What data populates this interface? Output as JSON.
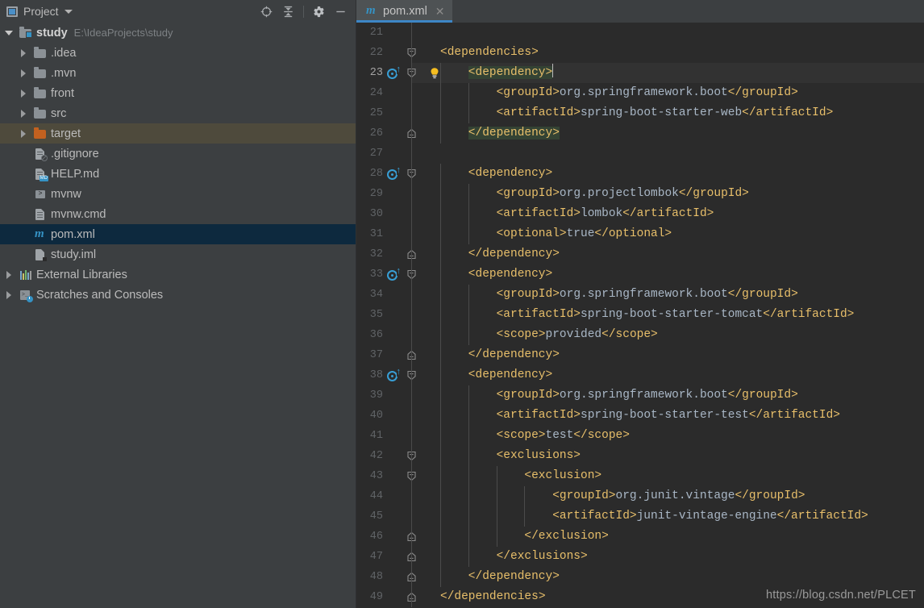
{
  "window": {
    "theme_bg": "#3c3f41",
    "editor_bg": "#2b2b2b",
    "accent": "#3d86c6"
  },
  "sidebar": {
    "header": {
      "title": "Project",
      "project_icon": "project-panel-icon",
      "dropdown_icon": "chevron-down-icon",
      "tools": [
        {
          "name": "locate-icon",
          "label": "⊕"
        },
        {
          "name": "collapse-all-icon",
          "label": "≛"
        },
        {
          "name": "settings-gear-icon",
          "label": "⚙"
        },
        {
          "name": "hide-icon",
          "label": "—"
        }
      ]
    },
    "tree": [
      {
        "label": "study",
        "sub": "E:\\IdeaProjects\\study",
        "icon": "module-folder-icon",
        "arrow": "open",
        "indent": 0,
        "state": "normal",
        "bold": true
      },
      {
        "label": ".idea",
        "sub": "",
        "icon": "folder-icon",
        "arrow": "closed",
        "indent": 1,
        "state": "normal",
        "bold": false
      },
      {
        "label": ".mvn",
        "sub": "",
        "icon": "folder-icon",
        "arrow": "closed",
        "indent": 1,
        "state": "normal",
        "bold": false
      },
      {
        "label": "front",
        "sub": "",
        "icon": "folder-icon",
        "arrow": "closed",
        "indent": 1,
        "state": "normal",
        "bold": false
      },
      {
        "label": "src",
        "sub": "",
        "icon": "folder-icon",
        "arrow": "closed",
        "indent": 1,
        "state": "normal",
        "bold": false
      },
      {
        "label": "target",
        "sub": "",
        "icon": "excluded-folder-icon",
        "arrow": "closed",
        "indent": 1,
        "state": "hover",
        "bold": false
      },
      {
        "label": ".gitignore",
        "sub": "",
        "icon": "gitignore-file-icon",
        "arrow": "none",
        "indent": 1,
        "state": "normal",
        "bold": false
      },
      {
        "label": "HELP.md",
        "sub": "",
        "icon": "markdown-file-icon",
        "arrow": "none",
        "indent": 1,
        "state": "normal",
        "bold": false
      },
      {
        "label": "mvnw",
        "sub": "",
        "icon": "shell-script-icon",
        "arrow": "none",
        "indent": 1,
        "state": "normal",
        "bold": false
      },
      {
        "label": "mvnw.cmd",
        "sub": "",
        "icon": "text-file-icon",
        "arrow": "none",
        "indent": 1,
        "state": "normal",
        "bold": false
      },
      {
        "label": "pom.xml",
        "sub": "",
        "icon": "maven-pom-icon",
        "arrow": "none",
        "indent": 1,
        "state": "selected",
        "bold": false
      },
      {
        "label": "study.iml",
        "sub": "",
        "icon": "iml-file-icon",
        "arrow": "none",
        "indent": 1,
        "state": "normal",
        "bold": false
      },
      {
        "label": "External Libraries",
        "sub": "",
        "icon": "libraries-icon",
        "arrow": "closed",
        "indent": 0,
        "state": "normal",
        "bold": false
      },
      {
        "label": "Scratches and Consoles",
        "sub": "",
        "icon": "scratches-icon",
        "arrow": "closed",
        "indent": 0,
        "state": "normal",
        "bold": false
      }
    ]
  },
  "editor": {
    "tabs": [
      {
        "label": "pom.xml",
        "icon": "maven-pom-icon",
        "close_icon": "close-icon",
        "active": true
      }
    ],
    "current_line": 23,
    "caret_line": 23,
    "gutter": {
      "maven_icon_lines": [
        23,
        28,
        33,
        38
      ],
      "fold_start_lines": [
        22,
        23,
        28,
        33,
        38,
        42,
        43
      ],
      "fold_end_lines": [
        26,
        32,
        37,
        46,
        47,
        48,
        49
      ],
      "bulb_lines": [
        23
      ]
    },
    "lines": [
      {
        "n": 21,
        "indent": 0,
        "segments": []
      },
      {
        "n": 22,
        "indent": 0,
        "segments": [
          {
            "t": "<dependencies>",
            "c": "tag"
          }
        ]
      },
      {
        "n": 23,
        "indent": 1,
        "segments": [
          {
            "t": "<dependency>",
            "c": "tag",
            "hl": true
          }
        ]
      },
      {
        "n": 24,
        "indent": 2,
        "segments": [
          {
            "t": "<groupId>",
            "c": "tag"
          },
          {
            "t": "org.springframework.boot",
            "c": "txt"
          },
          {
            "t": "</groupId>",
            "c": "tag"
          }
        ]
      },
      {
        "n": 25,
        "indent": 2,
        "segments": [
          {
            "t": "<artifactId>",
            "c": "tag"
          },
          {
            "t": "spring-boot-starter-web",
            "c": "txt"
          },
          {
            "t": "</artifactId>",
            "c": "tag"
          }
        ]
      },
      {
        "n": 26,
        "indent": 1,
        "segments": [
          {
            "t": "</dependency>",
            "c": "tag",
            "hl": true
          }
        ]
      },
      {
        "n": 27,
        "indent": 0,
        "segments": []
      },
      {
        "n": 28,
        "indent": 1,
        "segments": [
          {
            "t": "<dependency>",
            "c": "tag"
          }
        ]
      },
      {
        "n": 29,
        "indent": 2,
        "segments": [
          {
            "t": "<groupId>",
            "c": "tag"
          },
          {
            "t": "org.projectlombok",
            "c": "txt"
          },
          {
            "t": "</groupId>",
            "c": "tag"
          }
        ]
      },
      {
        "n": 30,
        "indent": 2,
        "segments": [
          {
            "t": "<artifactId>",
            "c": "tag"
          },
          {
            "t": "lombok",
            "c": "txt"
          },
          {
            "t": "</artifactId>",
            "c": "tag"
          }
        ]
      },
      {
        "n": 31,
        "indent": 2,
        "segments": [
          {
            "t": "<optional>",
            "c": "tag"
          },
          {
            "t": "true",
            "c": "txt"
          },
          {
            "t": "</optional>",
            "c": "tag"
          }
        ]
      },
      {
        "n": 32,
        "indent": 1,
        "segments": [
          {
            "t": "</dependency>",
            "c": "tag"
          }
        ]
      },
      {
        "n": 33,
        "indent": 1,
        "segments": [
          {
            "t": "<dependency>",
            "c": "tag"
          }
        ]
      },
      {
        "n": 34,
        "indent": 2,
        "segments": [
          {
            "t": "<groupId>",
            "c": "tag"
          },
          {
            "t": "org.springframework.boot",
            "c": "txt"
          },
          {
            "t": "</groupId>",
            "c": "tag"
          }
        ]
      },
      {
        "n": 35,
        "indent": 2,
        "segments": [
          {
            "t": "<artifactId>",
            "c": "tag"
          },
          {
            "t": "spring-boot-starter-tomcat",
            "c": "txt"
          },
          {
            "t": "</artifactId>",
            "c": "tag"
          }
        ]
      },
      {
        "n": 36,
        "indent": 2,
        "segments": [
          {
            "t": "<scope>",
            "c": "tag"
          },
          {
            "t": "provided",
            "c": "txt"
          },
          {
            "t": "</scope>",
            "c": "tag"
          }
        ]
      },
      {
        "n": 37,
        "indent": 1,
        "segments": [
          {
            "t": "</dependency>",
            "c": "tag"
          }
        ]
      },
      {
        "n": 38,
        "indent": 1,
        "segments": [
          {
            "t": "<dependency>",
            "c": "tag"
          }
        ]
      },
      {
        "n": 39,
        "indent": 2,
        "segments": [
          {
            "t": "<groupId>",
            "c": "tag"
          },
          {
            "t": "org.springframework.boot",
            "c": "txt"
          },
          {
            "t": "</groupId>",
            "c": "tag"
          }
        ]
      },
      {
        "n": 40,
        "indent": 2,
        "segments": [
          {
            "t": "<artifactId>",
            "c": "tag"
          },
          {
            "t": "spring-boot-starter-test",
            "c": "txt"
          },
          {
            "t": "</artifactId>",
            "c": "tag"
          }
        ]
      },
      {
        "n": 41,
        "indent": 2,
        "segments": [
          {
            "t": "<scope>",
            "c": "tag"
          },
          {
            "t": "test",
            "c": "txt"
          },
          {
            "t": "</scope>",
            "c": "tag"
          }
        ]
      },
      {
        "n": 42,
        "indent": 2,
        "segments": [
          {
            "t": "<exclusions>",
            "c": "tag"
          }
        ]
      },
      {
        "n": 43,
        "indent": 3,
        "segments": [
          {
            "t": "<exclusion>",
            "c": "tag"
          }
        ]
      },
      {
        "n": 44,
        "indent": 4,
        "segments": [
          {
            "t": "<groupId>",
            "c": "tag"
          },
          {
            "t": "org.junit.vintage",
            "c": "txt"
          },
          {
            "t": "</groupId>",
            "c": "tag"
          }
        ]
      },
      {
        "n": 45,
        "indent": 4,
        "segments": [
          {
            "t": "<artifactId>",
            "c": "tag"
          },
          {
            "t": "junit-vintage-engine",
            "c": "txt"
          },
          {
            "t": "</artifactId>",
            "c": "tag"
          }
        ]
      },
      {
        "n": 46,
        "indent": 3,
        "segments": [
          {
            "t": "</exclusion>",
            "c": "tag"
          }
        ]
      },
      {
        "n": 47,
        "indent": 2,
        "segments": [
          {
            "t": "</exclusions>",
            "c": "tag"
          }
        ]
      },
      {
        "n": 48,
        "indent": 1,
        "segments": [
          {
            "t": "</dependency>",
            "c": "tag"
          }
        ]
      },
      {
        "n": 49,
        "indent": 0,
        "segments": [
          {
            "t": "</dependencies>",
            "c": "tag"
          }
        ]
      }
    ]
  },
  "watermark": {
    "text": "https://blog.csdn.net/PLCET"
  }
}
